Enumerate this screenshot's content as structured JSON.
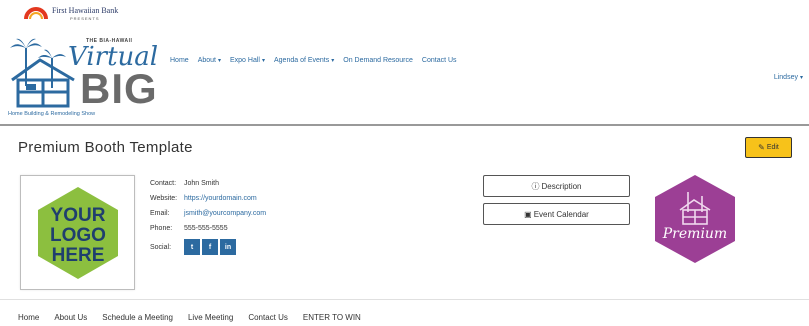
{
  "sponsor": {
    "name": "First Hawaiian Bank",
    "presents": "PRESENTS"
  },
  "brand": {
    "top": "THE BIA-HAWAII",
    "virtual": "Virtual",
    "big": "BIG",
    "subtitle": "Home Building & Remodeling Show"
  },
  "nav": {
    "items": [
      {
        "label": "Home",
        "caret": ""
      },
      {
        "label": "About",
        "caret": "▾"
      },
      {
        "label": "Expo Hall",
        "caret": "▾"
      },
      {
        "label": "Agenda of Events",
        "caret": "▾"
      },
      {
        "label": "On Demand Resource",
        "caret": ""
      },
      {
        "label": "Contact Us",
        "caret": ""
      }
    ],
    "user": "Lindsey",
    "user_caret": "▾"
  },
  "booth": {
    "title": "Premium Booth Template",
    "edit_label": "Edit",
    "logo_text": [
      "YOUR",
      "LOGO",
      "HERE"
    ],
    "contact": {
      "contact_label": "Contact:",
      "contact_value": "John Smith",
      "website_label": "Website:",
      "website_value": "https://yourdomain.com",
      "email_label": "Email:",
      "email_value": "jsmith@yourcompany.com",
      "phone_label": "Phone:",
      "phone_value": "555-555-5555",
      "social_label": "Social:"
    },
    "social": [
      "t",
      "f",
      "in"
    ],
    "description_label": "Description",
    "calendar_label": "Event Calendar",
    "premium_label": "Premium"
  },
  "footer": {
    "items": [
      "Home",
      "About Us",
      "Schedule a Meeting",
      "Live Meeting",
      "Contact Us",
      "ENTER TO WIN"
    ]
  },
  "colors": {
    "brand_blue": "#2c6aa0",
    "edit_yellow": "#f7c21a",
    "logo_green": "#8cbf3f",
    "premium_purple": "#9c3f95"
  }
}
